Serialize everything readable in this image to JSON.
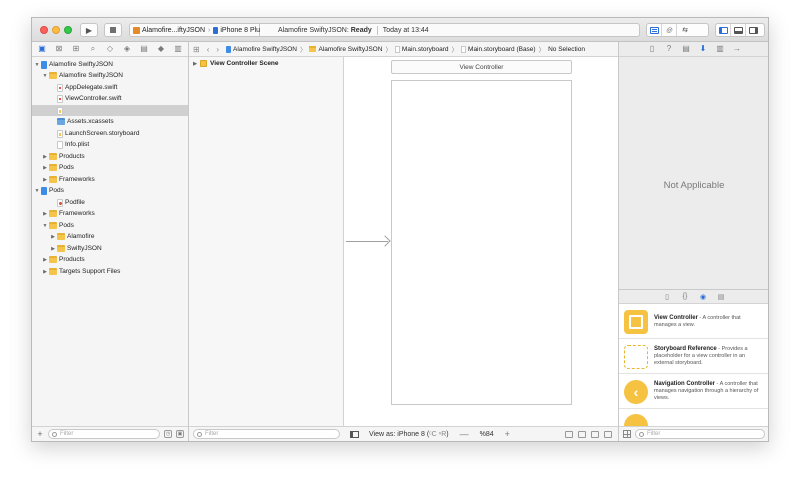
{
  "toolbar": {
    "scheme_name": "Alamofire...iftyJSON",
    "device": "iPhone 8 Plus",
    "status_project": "Alamofire SwiftyJSON:",
    "status_state": "Ready",
    "status_time": "Today at 13:44",
    "run_glyph": "▶",
    "colors": {
      "close": "#fc605c",
      "minimize": "#fdbc40",
      "zoom": "#34c84a",
      "accent": "#2b6dd9"
    }
  },
  "navigator": {
    "tabs": [
      "folder-icon",
      "source-control-icon",
      "symbol-icon",
      "find-icon",
      "issue-icon",
      "test-icon",
      "debug-icon",
      "breakpoint-icon",
      "report-icon"
    ],
    "tab_glyphs": [
      "▣",
      "⊠",
      "⊞",
      "⌕",
      "◇",
      "◈",
      "▤",
      "◆",
      "▥"
    ],
    "items": [
      {
        "label": "Alamofire SwiftyJSON",
        "icon": "project-icon",
        "expanded": true
      },
      {
        "label": "Alamofire SwiftyJSON",
        "icon": "folder-icon",
        "expanded": true
      },
      {
        "label": "AppDelegate.swift",
        "icon": "swift-file-icon"
      },
      {
        "label": "ViewController.swift",
        "icon": "swift-file-icon"
      },
      {
        "label": "",
        "icon": "storyboard-icon",
        "selected": true
      },
      {
        "label": "Assets.xcassets",
        "icon": "asset-catalog-icon"
      },
      {
        "label": "LaunchScreen.storyboard",
        "icon": "storyboard-icon"
      },
      {
        "label": "Info.plist",
        "icon": "plist-icon"
      },
      {
        "label": "Products",
        "icon": "folder-icon",
        "expanded": false
      },
      {
        "label": "Pods",
        "icon": "folder-icon",
        "expanded": false
      },
      {
        "label": "Frameworks",
        "icon": "folder-icon",
        "expanded": false
      },
      {
        "label": "Pods",
        "icon": "project-icon",
        "expanded": true
      },
      {
        "label": "Podfile",
        "icon": "podfile-icon"
      },
      {
        "label": "Frameworks",
        "icon": "folder-icon",
        "expanded": false
      },
      {
        "label": "Pods",
        "icon": "folder-icon",
        "expanded": true
      },
      {
        "label": "Alamofire",
        "icon": "folder-icon",
        "expanded": false
      },
      {
        "label": "SwiftyJSON",
        "icon": "folder-icon",
        "expanded": false
      },
      {
        "label": "Products",
        "icon": "folder-icon",
        "expanded": false
      },
      {
        "label": "Targets Support Files",
        "icon": "folder-icon",
        "expanded": false
      }
    ],
    "filter_placeholder": "Filter",
    "add_glyph": "+"
  },
  "jumpbar": {
    "crumbs": [
      "Alamofire SwiftyJSON",
      "Alamofire SwiftyJSON",
      "Main.storyboard",
      "Main.storyboard (Base)",
      "No Selection"
    ],
    "chevron": "〉"
  },
  "outline": {
    "scene_label": "View Controller Scene",
    "filter_placeholder": "Filter"
  },
  "canvas": {
    "scene_header": "View Controller",
    "view_as_label": "View as: iPhone 8 (",
    "view_as_hint": "ᶜC ⁿR",
    "view_as_close": ")",
    "zoom_out": "—",
    "zoom_value": "%84",
    "zoom_in": "+"
  },
  "inspector": {
    "tabs": [
      "file-inspector-icon",
      "quick-help-icon",
      "identity-inspector-icon",
      "attributes-inspector-icon",
      "size-inspector-icon",
      "connections-inspector-icon"
    ],
    "tab_glyphs": [
      "▯",
      "?",
      "▤",
      "⬇",
      "▥",
      "→"
    ],
    "empty_message": "Not Applicable",
    "library_tabs": [
      "▯",
      "{}",
      "◉",
      "▤"
    ],
    "library_items": [
      {
        "title": "View Controller",
        "description": " - A controller that manages a view."
      },
      {
        "title": "Storyboard Reference",
        "description": " - Provides a placeholder for a view controller in an external storyboard."
      },
      {
        "title": "Navigation Controller",
        "description": " - A controller that manages navigation through a hierarchy of views."
      },
      {
        "title": "",
        "description": ""
      }
    ],
    "filter_placeholder": "Filter"
  }
}
